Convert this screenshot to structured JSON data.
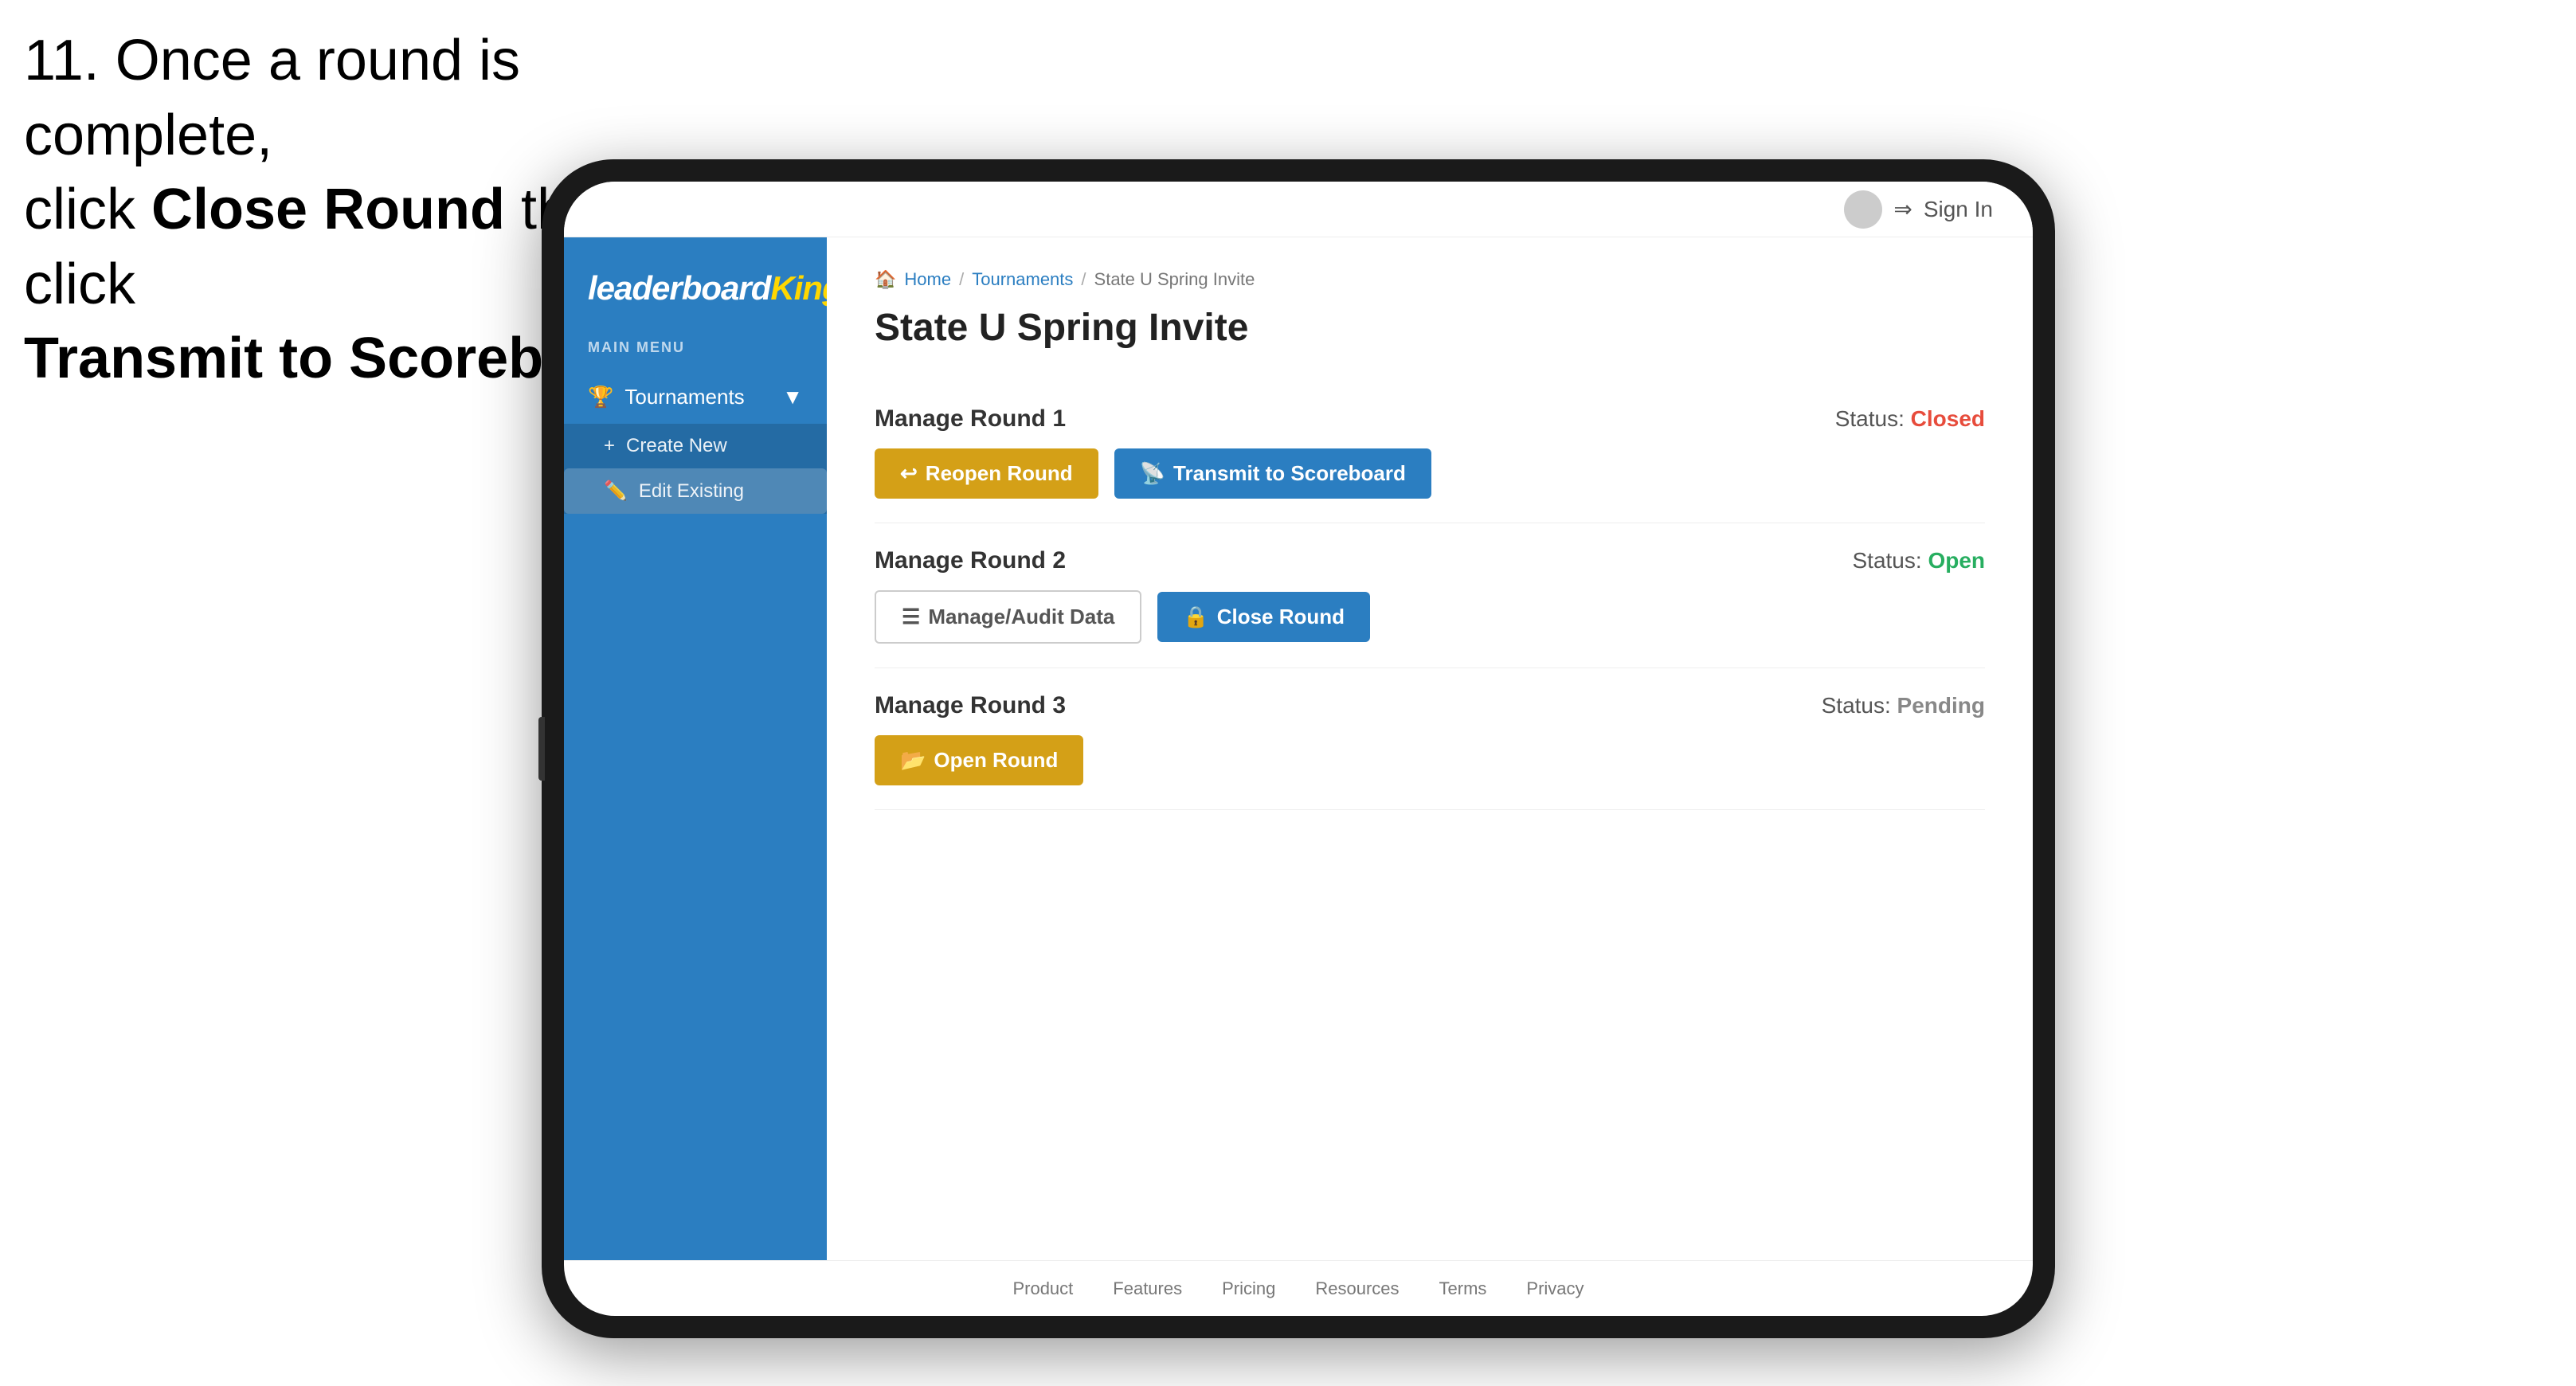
{
  "instruction": {
    "line1": "11. Once a round is complete,",
    "line2_prefix": "click ",
    "line2_bold": "Close Round",
    "line2_suffix": " then click",
    "line3_bold": "Transmit to Scoreboard."
  },
  "topbar": {
    "sign_in": "Sign In"
  },
  "sidebar": {
    "logo": "leaderboard",
    "logo_king": "King",
    "main_menu_label": "MAIN MENU",
    "tournaments_label": "Tournaments",
    "create_new_label": "Create New",
    "edit_existing_label": "Edit Existing"
  },
  "breadcrumb": {
    "home": "Home",
    "tournaments": "Tournaments",
    "current": "State U Spring Invite"
  },
  "page": {
    "title": "State U Spring Invite"
  },
  "rounds": [
    {
      "id": "round1",
      "title": "Manage Round 1",
      "status_label": "Status:",
      "status_value": "Closed",
      "status_class": "status-closed",
      "button1_label": "Reopen Round",
      "button1_class": "btn-gold",
      "button2_label": "Transmit to Scoreboard",
      "button2_class": "btn-blue"
    },
    {
      "id": "round2",
      "title": "Manage Round 2",
      "status_label": "Status:",
      "status_value": "Open",
      "status_class": "status-open",
      "button1_label": "Manage/Audit Data",
      "button1_class": "btn-outline",
      "button2_label": "Close Round",
      "button2_class": "btn-blue"
    },
    {
      "id": "round3",
      "title": "Manage Round 3",
      "status_label": "Status:",
      "status_value": "Pending",
      "status_class": "status-pending",
      "button1_label": "Open Round",
      "button1_class": "btn-gold"
    }
  ],
  "footer": {
    "links": [
      "Product",
      "Features",
      "Pricing",
      "Resources",
      "Terms",
      "Privacy"
    ]
  }
}
